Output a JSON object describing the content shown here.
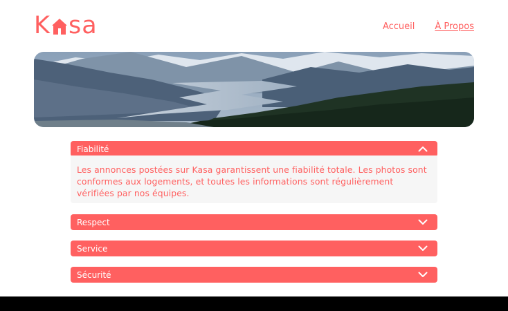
{
  "brand": {
    "logo_prefix": "K",
    "logo_suffix": "sa",
    "logo_word": "Kasa",
    "accent_color": "#ff6060"
  },
  "nav": {
    "items": [
      {
        "label": "Accueil",
        "active": false
      },
      {
        "label": "À Propos",
        "active": true
      }
    ]
  },
  "banner": {
    "description_icon": "mountain-landscape-image"
  },
  "accordion": {
    "items": [
      {
        "title": "Fiabilité",
        "open": true,
        "icon": "chevron-up-icon",
        "body": "Les annonces postées sur Kasa garantissent une fiabilité totale. Les photos sont conformes aux logements, et toutes les informations sont régulièrement vérifiées par nos équipes."
      },
      {
        "title": "Respect",
        "open": false,
        "icon": "chevron-down-icon"
      },
      {
        "title": "Service",
        "open": false,
        "icon": "chevron-down-icon"
      },
      {
        "title": "Sécurité",
        "open": false,
        "icon": "chevron-down-icon"
      }
    ]
  }
}
